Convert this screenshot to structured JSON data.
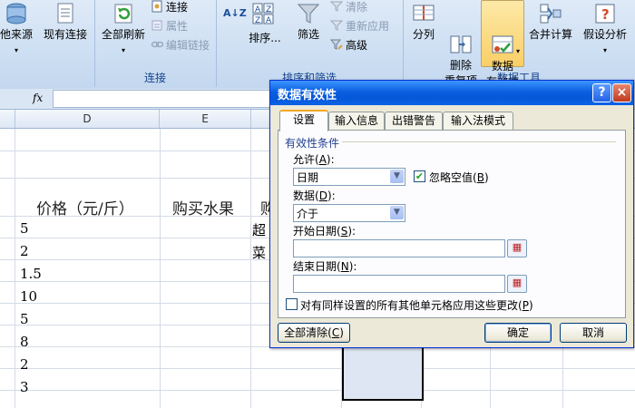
{
  "ribbon": {
    "other_source": "他来源",
    "existing_conn": "现有连接",
    "refresh_all": "全部刷新",
    "connections": "连接",
    "properties": "属性",
    "edit_links": "编辑链接",
    "group_connections": "连接",
    "sort": "排序...",
    "filter": "筛选",
    "clear": "清除",
    "reapply": "重新应用",
    "advanced": "高级",
    "group_sort_filter": "排序和筛选",
    "split": "分列",
    "remove_dup": "删除\n重复项",
    "data_validation": "数据\n有效性",
    "group_data_tools": "数据工具",
    "consolidate": "合并计算",
    "whatif": "假设分析"
  },
  "formula_bar": {
    "fx": "fx"
  },
  "columns": [
    "D",
    "E"
  ],
  "cells": {
    "header_price": "价格（元/斤）",
    "header_buy": "购买水果",
    "partial_f_header": "购",
    "partial_f1": "超",
    "partial_f2": "菜",
    "values": [
      "5",
      "2",
      "1.5",
      "10",
      "5",
      "8",
      "2",
      "3"
    ]
  },
  "dialog": {
    "title": "数据有效性",
    "help": "?",
    "close": "×",
    "tabs": [
      "设置",
      "输入信息",
      "出错警告",
      "输入法模式"
    ],
    "section": "有效性条件",
    "allow_label": "允许",
    "allow_key": "A",
    "allow_value": "日期",
    "ignore_blank": "忽略空值",
    "ignore_blank_key": "B",
    "ignore_checked": true,
    "data_label": "数据",
    "data_key": "D",
    "data_value": "介于",
    "start_label": "开始日期",
    "start_key": "S",
    "end_label": "结束日期",
    "end_key": "N",
    "apply_all": "对有同样设置的所有其他单元格应用这些更改",
    "apply_key": "P",
    "clear_all": "全部清除",
    "clear_key": "C",
    "ok": "确定",
    "cancel": "取消"
  }
}
